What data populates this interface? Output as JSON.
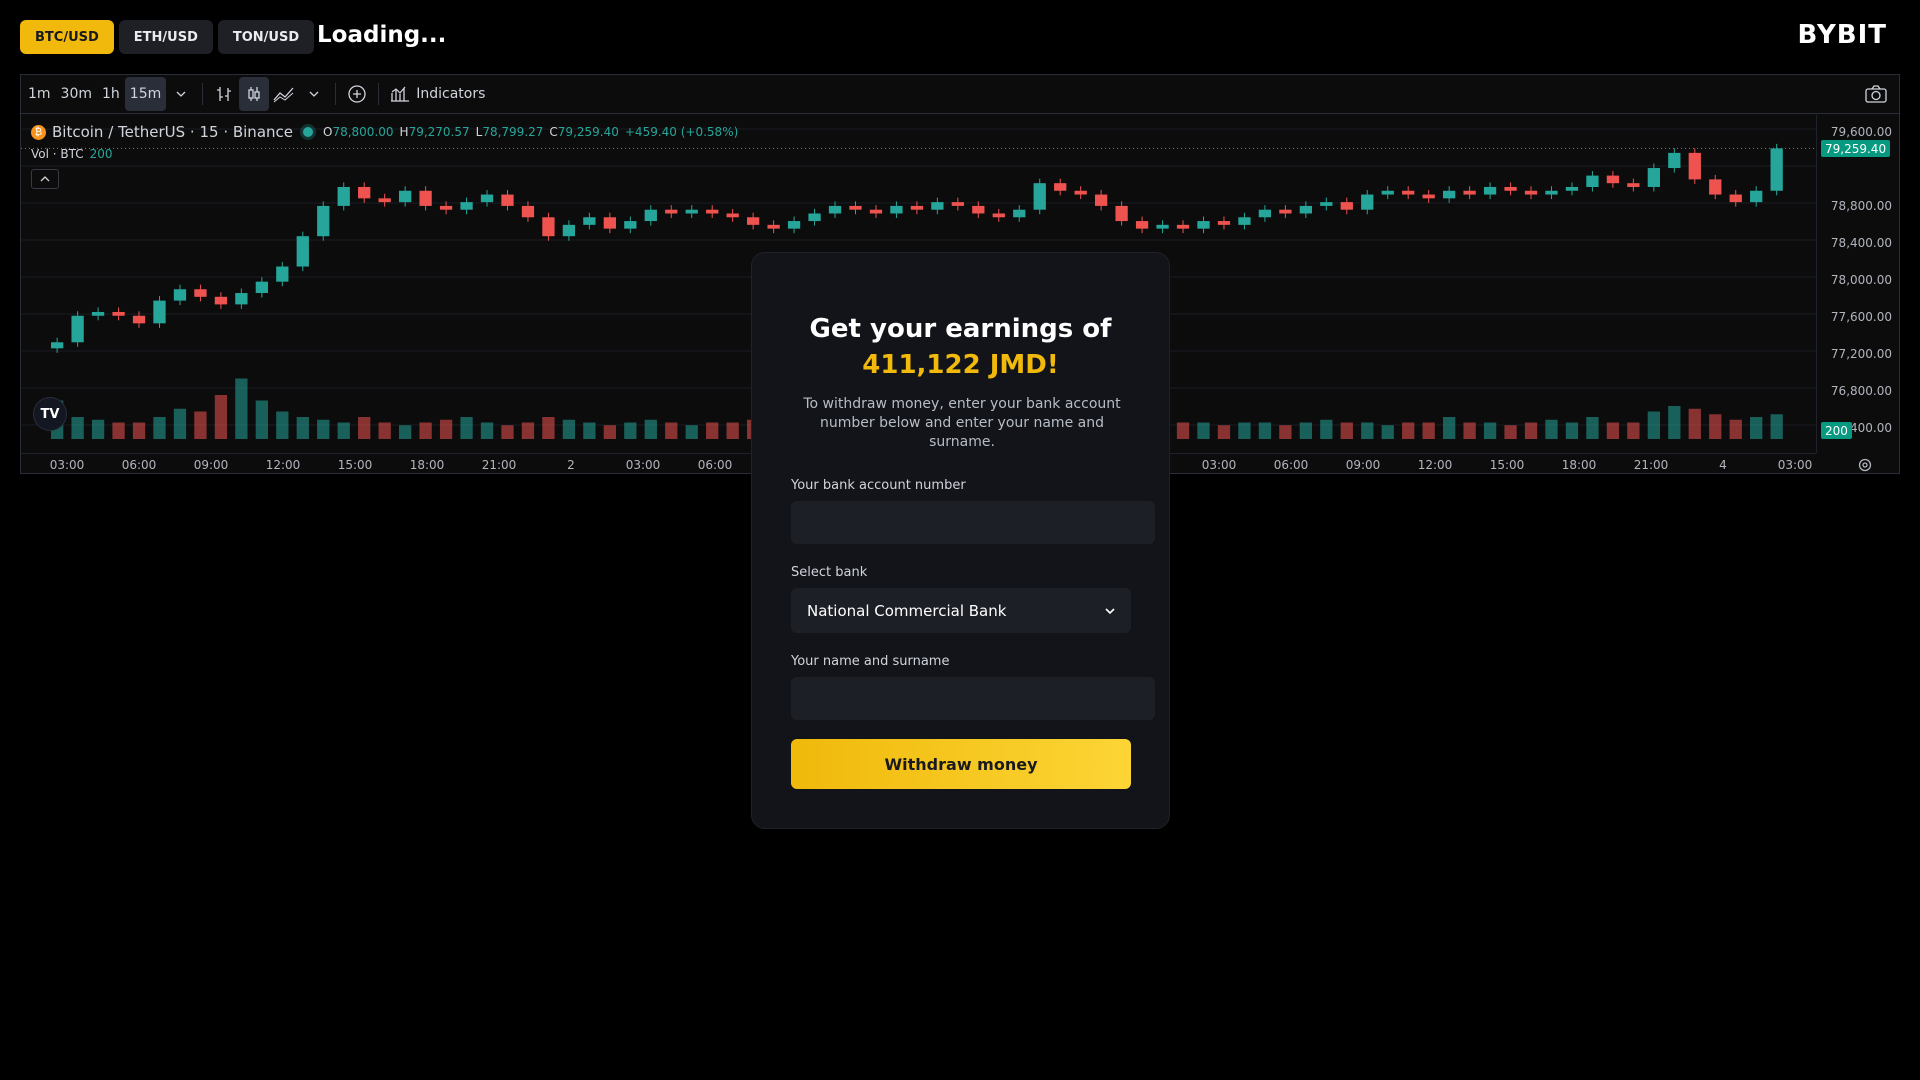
{
  "pair_tabs": [
    {
      "label": "BTC/USD",
      "active": true
    },
    {
      "label": "ETH/USD",
      "active": false
    },
    {
      "label": "TON/USD",
      "active": false
    }
  ],
  "status_text": "Loading...",
  "brand": "BYBIT",
  "chart": {
    "toolbar": {
      "intervals": [
        "1m",
        "30m",
        "1h",
        "15m"
      ],
      "active_interval": "15m",
      "indicators_label": "Indicators"
    },
    "legend": {
      "symbol": "Bitcoin / TetherUS · 15 · Binance",
      "o_label": "O",
      "o": "78,800.00",
      "h_label": "H",
      "h": "79,270.57",
      "l_label": "L",
      "l": "78,799.27",
      "c_label": "C",
      "c": "79,259.40",
      "change": "+459.40 (+0.58%)"
    },
    "volume_legend": {
      "label": "Vol · BTC",
      "value": "200"
    },
    "current_price": "79,259.40",
    "volume_tag": "200",
    "up_color": "#26a69a",
    "down_color": "#ef5350"
  },
  "chart_data": {
    "type": "candlestick",
    "price_axis_labels": [
      "79,600.00",
      "78,800.00",
      "78,400.00",
      "78,000.00",
      "77,600.00",
      "77,200.00",
      "76,800.00",
      "76,400.00"
    ],
    "time_axis_labels": [
      "03:00",
      "06:00",
      "09:00",
      "12:00",
      "15:00",
      "18:00",
      "21:00",
      "2",
      "03:00",
      "06:00",
      "03:00",
      "06:00",
      "09:00",
      "12:00",
      "15:00",
      "18:00",
      "21:00",
      "4",
      "03:00"
    ],
    "ylim": [
      76400,
      79700
    ],
    "close_series": [
      76700,
      77050,
      77100,
      77050,
      76950,
      77250,
      77400,
      77300,
      77200,
      77350,
      77500,
      77700,
      78100,
      78500,
      78750,
      78600,
      78550,
      78700,
      78500,
      78450,
      78550,
      78650,
      78500,
      78350,
      78100,
      78250,
      78350,
      78200,
      78300,
      78450,
      78400,
      78450,
      78400,
      78350,
      78250,
      78200,
      78300,
      78400,
      78500,
      78450,
      78400,
      78500,
      78450,
      78550,
      78500,
      78400,
      78350,
      78450,
      78800,
      78700,
      78650,
      78500,
      78300,
      78200,
      78250,
      78200,
      78300,
      78250,
      78350,
      78450,
      78400,
      78500,
      78550,
      78450,
      78650,
      78700,
      78650,
      78600,
      78700,
      78650,
      78750,
      78700,
      78650,
      78700,
      78750,
      78900,
      78800,
      78750,
      79000,
      79200,
      78850,
      78650,
      78550,
      78700,
      79259
    ],
    "volume_series": [
      70,
      40,
      35,
      30,
      30,
      40,
      55,
      50,
      80,
      110,
      70,
      50,
      40,
      35,
      30,
      40,
      30,
      25,
      30,
      35,
      40,
      30,
      25,
      30,
      40,
      35,
      30,
      25,
      30,
      35,
      30,
      25,
      30,
      30,
      35,
      30,
      25,
      30,
      35,
      30,
      25,
      30,
      30,
      25,
      30,
      30,
      35,
      30,
      40,
      35,
      30,
      30,
      35,
      30,
      25,
      30,
      30,
      25,
      30,
      30,
      25,
      30,
      35,
      30,
      30,
      25,
      30,
      30,
      40,
      30,
      30,
      25,
      30,
      35,
      30,
      40,
      30,
      30,
      50,
      60,
      55,
      45,
      35,
      40,
      45
    ]
  },
  "modal": {
    "title": "Get your earnings of",
    "amount": "411,122 JMD!",
    "description": "To withdraw money, enter your bank account number below and enter your name and surname.",
    "account_label": "Your bank account number",
    "account_value": "",
    "bank_label": "Select bank",
    "bank_selected": "National Commercial Bank",
    "name_label": "Your name and surname",
    "name_value": "",
    "submit_label": "Withdraw money",
    "accent": "#f0b90b"
  }
}
